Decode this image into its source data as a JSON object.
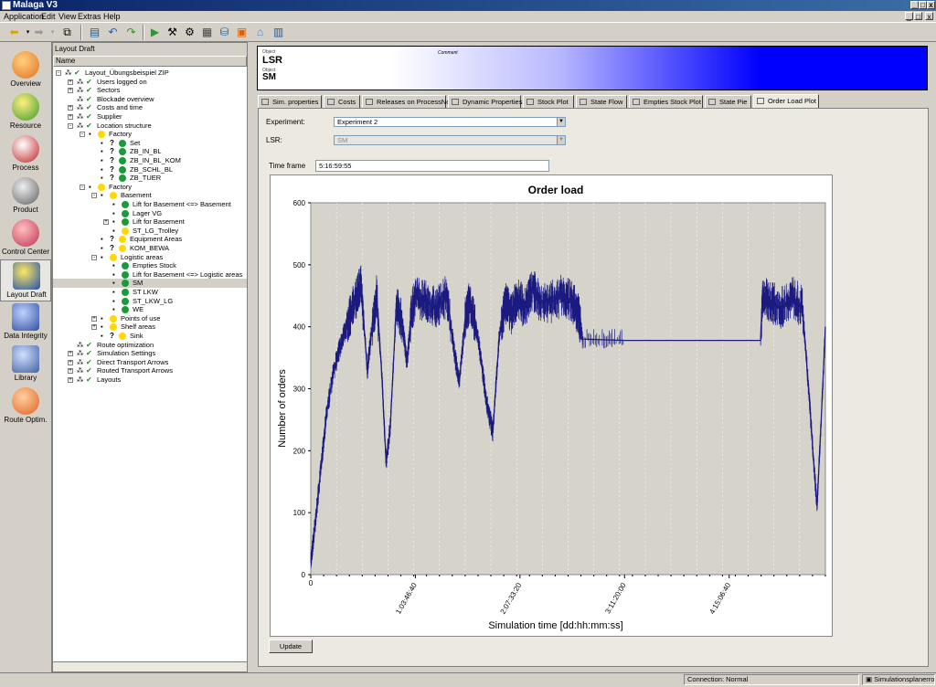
{
  "window": {
    "title": "Malaga V3",
    "min_label": "_",
    "max_label": "□",
    "close_label": "x"
  },
  "menu": {
    "items": [
      "Application",
      "Edit",
      "View",
      "Extras",
      "Help"
    ],
    "mdi_min": "_",
    "mdi_restore": "□",
    "mdi_close": "x"
  },
  "sidebar": {
    "items": [
      {
        "label": "Overview",
        "icon": "overview-icon",
        "color": "#e07020"
      },
      {
        "label": "Resource",
        "icon": "resource-icon",
        "color": "#3a9a2a"
      },
      {
        "label": "Process",
        "icon": "process-icon",
        "color": "#c02020"
      },
      {
        "label": "Product",
        "icon": "product-icon",
        "color": "#606060"
      },
      {
        "label": "Control Center",
        "icon": "control-center-icon",
        "color": "#c03050"
      },
      {
        "label": "Layout Draft",
        "icon": "layout-draft-icon",
        "color": "#2050b0"
      },
      {
        "label": "Data Integrity",
        "icon": "data-integrity-icon",
        "color": "#3050a0"
      },
      {
        "label": "Library",
        "icon": "library-icon",
        "color": "#4060a0"
      },
      {
        "label": "Route Optim.",
        "icon": "route-optim-icon",
        "color": "#e06020"
      }
    ],
    "active": "Layout Draft"
  },
  "tree_panel": {
    "title": "Layout Draft",
    "column": "Name",
    "rows": [
      {
        "label": "Layout_Übungsbeispiel ZIP",
        "level": 0,
        "exp": "-",
        "icon": "tick"
      },
      {
        "label": "Users logged on",
        "level": 1,
        "exp": "+",
        "icon": "tick"
      },
      {
        "label": "Sectors",
        "level": 1,
        "exp": "+",
        "icon": "tick"
      },
      {
        "label": "Blockade overview",
        "level": 1,
        "exp": "",
        "icon": "tick"
      },
      {
        "label": "Costs and time",
        "level": 1,
        "exp": "+",
        "icon": "tick"
      },
      {
        "label": "Supplier",
        "level": 1,
        "exp": "+",
        "icon": "tick"
      },
      {
        "label": "Location structure",
        "level": 1,
        "exp": "-",
        "icon": "tick"
      },
      {
        "label": "Factory",
        "level": 2,
        "exp": "-",
        "icon": "warn"
      },
      {
        "label": "Set",
        "level": 3,
        "exp": "",
        "icon": "qgreen"
      },
      {
        "label": "ZB_IN_BL",
        "level": 3,
        "exp": "",
        "icon": "qgreen"
      },
      {
        "label": "ZB_IN_BL_KOM",
        "level": 3,
        "exp": "",
        "icon": "qgreen"
      },
      {
        "label": "ZB_SCHL_BL",
        "level": 3,
        "exp": "",
        "icon": "qgreen"
      },
      {
        "label": "ZB_TUER",
        "level": 3,
        "exp": "",
        "icon": "qgreen"
      },
      {
        "label": "Factory",
        "level": 2,
        "exp": "-",
        "icon": "warn"
      },
      {
        "label": "Basement",
        "level": 3,
        "exp": "-",
        "icon": "warn"
      },
      {
        "label": "Lift for Basement <=> Basement",
        "level": 4,
        "exp": "",
        "icon": "green"
      },
      {
        "label": "Lager VG",
        "level": 4,
        "exp": "",
        "icon": "green"
      },
      {
        "label": "Lift for Basement",
        "level": 4,
        "exp": "+",
        "icon": "green"
      },
      {
        "label": "ST_LG_Trolley",
        "level": 4,
        "exp": "",
        "icon": "warn"
      },
      {
        "label": "Equipment Areas",
        "level": 3,
        "exp": "",
        "icon": "qwarn"
      },
      {
        "label": "KOM_BEWA",
        "level": 3,
        "exp": "",
        "icon": "qwarn"
      },
      {
        "label": "Logistic areas",
        "level": 3,
        "exp": "-",
        "icon": "warn"
      },
      {
        "label": "Empties Stock",
        "level": 4,
        "exp": "",
        "icon": "green"
      },
      {
        "label": "Lift for Basement <=> Logistic areas",
        "level": 4,
        "exp": "",
        "icon": "green"
      },
      {
        "label": "SM",
        "level": 4,
        "exp": "",
        "icon": "green",
        "selected": true
      },
      {
        "label": "ST LKW",
        "level": 4,
        "exp": "",
        "icon": "green"
      },
      {
        "label": "ST_LKW_LG",
        "level": 4,
        "exp": "",
        "icon": "green"
      },
      {
        "label": "WE",
        "level": 4,
        "exp": "",
        "icon": "green"
      },
      {
        "label": "Points of use",
        "level": 3,
        "exp": "+",
        "icon": "warn"
      },
      {
        "label": "Shelf areas",
        "level": 3,
        "exp": "+",
        "icon": "warn"
      },
      {
        "label": "Sink",
        "level": 3,
        "exp": "",
        "icon": "qwarn"
      },
      {
        "label": "Route optimization",
        "level": 1,
        "exp": "",
        "icon": "tick"
      },
      {
        "label": "Simulation Settings",
        "level": 1,
        "exp": "+",
        "icon": "tick"
      },
      {
        "label": "Direct Transport Arrows",
        "level": 1,
        "exp": "+",
        "icon": "tick"
      },
      {
        "label": "Routed Transport Arrows",
        "level": 1,
        "exp": "+",
        "icon": "tick"
      },
      {
        "label": "Layouts",
        "level": 1,
        "exp": "+",
        "icon": "tick"
      }
    ]
  },
  "banner": {
    "object_caption_1": "Object",
    "lsr": "LSR",
    "object_caption_2": "Object",
    "sm": "SM",
    "comment_caption": "Comment"
  },
  "tabs": [
    {
      "label": "Sim. properties",
      "width": 70
    },
    {
      "label": "Costs",
      "width": 40
    },
    {
      "label": "Releases on ProcessNode",
      "width": 92
    },
    {
      "label": "Dynamic Properties",
      "width": 80
    },
    {
      "label": "Stock Plot",
      "width": 56
    },
    {
      "label": "State Flow",
      "width": 56
    },
    {
      "label": "Empties Stock Plot",
      "width": 81
    },
    {
      "label": "State Pie",
      "width": 51
    },
    {
      "label": "Order Load Plot",
      "width": 72,
      "active": true
    }
  ],
  "form": {
    "experiment_label": "Experiment:",
    "experiment_value": "Experiment 2",
    "lsr_label": "LSR:",
    "lsr_value": "SM",
    "timeframe_label": "Time frame",
    "timeframe_value": "5:16:59:55",
    "update_label": "Update"
  },
  "chart_data": {
    "type": "line",
    "title": "Order load",
    "xlabel": "Simulation time [dd:hh:mm:ss]",
    "ylabel": "Number of orders",
    "ylim": [
      0,
      600
    ],
    "yticks": [
      0,
      100,
      200,
      300,
      400,
      500,
      600
    ],
    "xticks": [
      "0",
      "1:03:46:40",
      "2:07:33:20",
      "3:11:20:00",
      "4:15:06:40"
    ],
    "xlim_seconds": [
      0,
      492000
    ],
    "color": "#1a1a80",
    "plot_bg": "#d6d3cb",
    "series": [
      {
        "x": [
          0,
          4000,
          9000,
          15000,
          22000,
          30000,
          36000,
          42000,
          48000,
          54000,
          58000,
          63000,
          68000,
          72000,
          76000,
          82000,
          88000,
          92000,
          96000,
          100000,
          110000,
          120000,
          130000,
          138000,
          142000,
          148000,
          152000,
          160000,
          168000,
          174000,
          180000,
          186000,
          192000,
          198000,
          204000,
          212000,
          220000,
          230000,
          240000,
          250000,
          256000,
          260000,
          300000,
          350000,
          400000,
          430000,
          432000,
          440000,
          450000,
          460000,
          470000,
          476000,
          480000,
          484000,
          488000,
          492000
        ],
        "y": [
          20,
          80,
          160,
          260,
          330,
          380,
          410,
          440,
          470,
          330,
          390,
          450,
          320,
          180,
          240,
          440,
          400,
          340,
          420,
          450,
          440,
          430,
          450,
          350,
          310,
          420,
          440,
          380,
          280,
          230,
          380,
          440,
          420,
          450,
          430,
          460,
          440,
          440,
          450,
          440,
          420,
          380,
          378,
          378,
          378,
          378,
          450,
          440,
          430,
          450,
          430,
          300,
          200,
          110,
          250,
          400
        ]
      }
    ]
  }
}
